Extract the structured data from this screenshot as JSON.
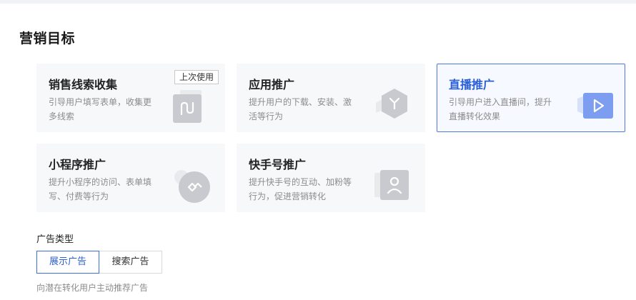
{
  "section_title": "营销目标",
  "cards": [
    {
      "title": "销售线索收集",
      "desc": "引导用户填写表单，收集更多线索",
      "badge": "上次使用",
      "icon": "form-icon"
    },
    {
      "title": "应用推广",
      "desc": "提升用户的下载、安装、激活等行为",
      "icon": "app-icon"
    },
    {
      "title": "直播推广",
      "desc": "引导用户进入直播间，提升直播转化效果",
      "icon": "live-play-icon",
      "selected": true
    },
    {
      "title": "小程序推广",
      "desc": "提升小程序的访问、表单填写、付费等行为",
      "icon": "mini-program-icon"
    },
    {
      "title": "快手号推广",
      "desc": "提升快手号的互动、加粉等行为，促进营销转化",
      "icon": "account-icon"
    }
  ],
  "ad_type": {
    "label": "广告类型",
    "options": [
      "展示广告",
      "搜索广告"
    ],
    "selected": "展示广告",
    "hint": "向潜在转化用户主动推荐广告"
  },
  "colors": {
    "accent": "#2b5fd9",
    "card_bg": "#f7f8fa",
    "selected_bg": "#f6f9ff",
    "muted_text": "#8c8c8c"
  }
}
